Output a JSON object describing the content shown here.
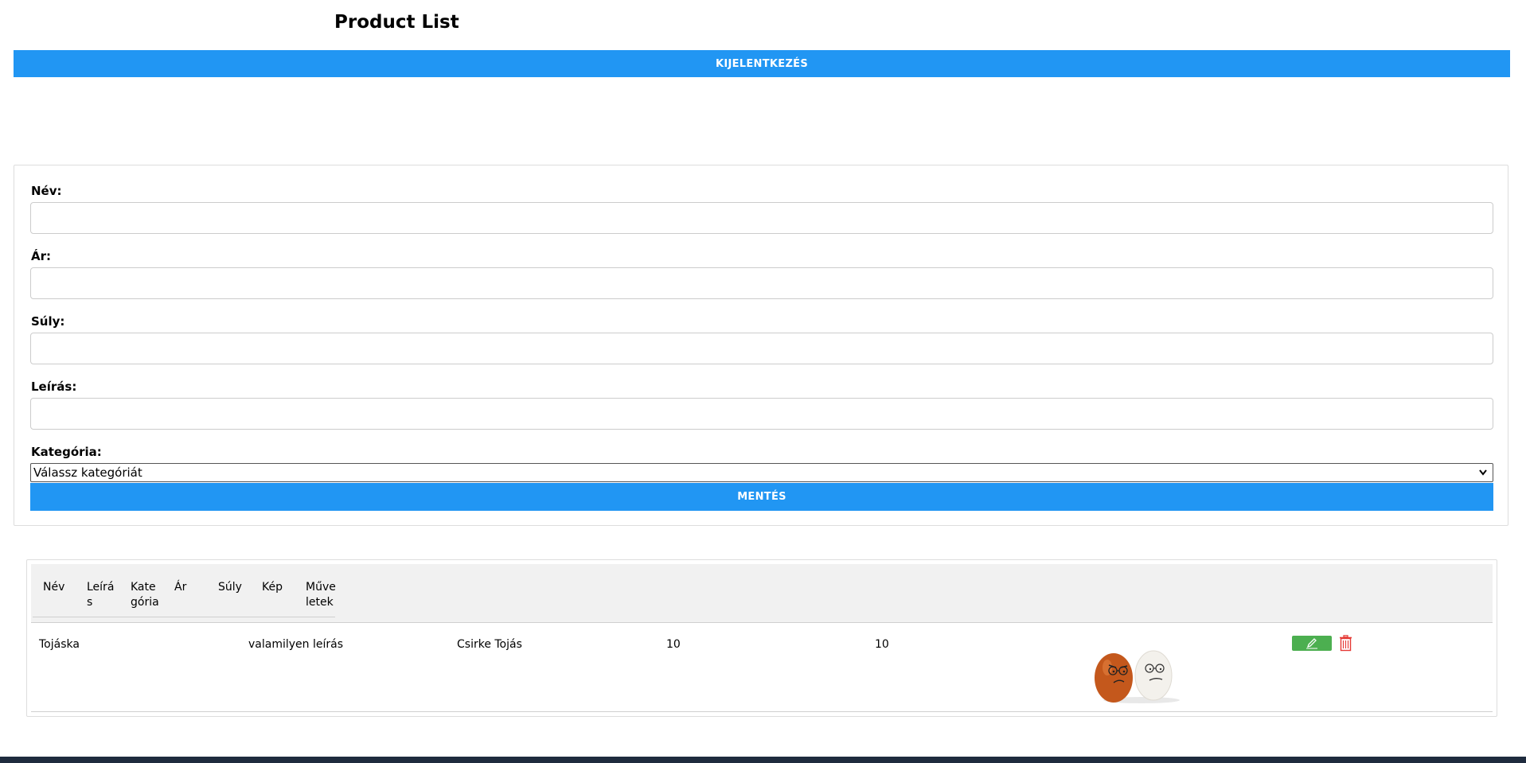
{
  "page": {
    "title": "Product List"
  },
  "header": {
    "logout_label": "KIJELENTKEZÉS"
  },
  "form": {
    "name_label": "Név:",
    "name_value": "",
    "price_label": "Ár:",
    "price_value": "",
    "weight_label": "Súly:",
    "weight_value": "",
    "description_label": "Leírás:",
    "description_value": "",
    "category_label": "Kategória:",
    "category_selected": "Válassz kategóriát",
    "save_label": "MENTÉS"
  },
  "table": {
    "columns": [
      "Név",
      "Leírá s",
      "Kate gória",
      "Ár",
      "Súly",
      "Kép",
      "Műve letek"
    ],
    "rows": [
      {
        "name": "Tojáska",
        "description": "valamilyen leírás",
        "category": "Csirke Tojás",
        "price": "10",
        "weight": "10",
        "image": "eggs-image"
      }
    ]
  },
  "icons": {
    "edit": "pencil-icon",
    "delete": "trash-icon"
  },
  "colors": {
    "primary": "#2196f3",
    "edit": "#4caf50",
    "delete": "#e53935",
    "header_bg": "#f1f1f1",
    "footer": "#1f2b3e"
  }
}
